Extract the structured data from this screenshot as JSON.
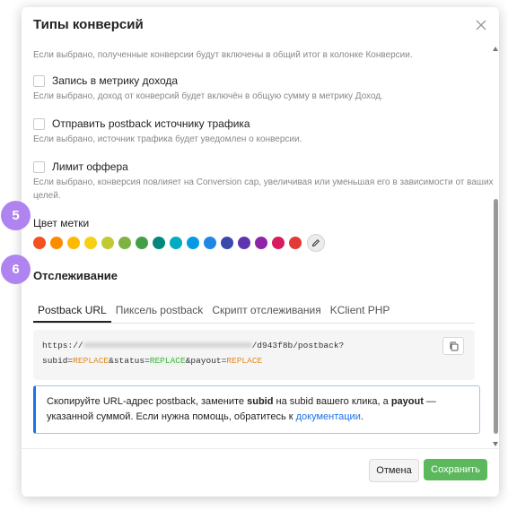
{
  "dialog": {
    "title": "Типы конверсий"
  },
  "hints": {
    "top": "Если выбрано, полученные конверсии будут включены в общий итог в колонке Конверсии.",
    "revenue": "Если выбрано, доход от конверсий будет включён в общую сумму в метрику Доход.",
    "postback": "Если выбрано, источник трафика будет уведомлен о конверсии.",
    "offer_limit_1": "Если выбрано, конверсия повлияет на Conversion cap, увеличивая или уменьшая его в зависимости от ваших",
    "offer_limit_2": "целей."
  },
  "options": {
    "revenue": "Запись в метрику дохода",
    "postback": "Отправить postback источнику трафика",
    "offer_limit": "Лимит оффера"
  },
  "label_color": {
    "title": "Цвет метки",
    "colors": [
      "#f4511e",
      "#fb8c00",
      "#fdb900",
      "#f7cf14",
      "#c0ca33",
      "#7cb342",
      "#43a047",
      "#00897b",
      "#00acc1",
      "#039be5",
      "#1e88e5",
      "#3949ab",
      "#5e35b1",
      "#8e24aa",
      "#d81b60",
      "#e53935"
    ],
    "edit_icon": "pencil-icon"
  },
  "tracking": {
    "title": "Отслеживание",
    "tabs": [
      "Postback URL",
      "Пиксель postback",
      "Скрипт отслеживания",
      "KClient PHP"
    ],
    "active_tab": "Postback URL",
    "url_prefix": "https://",
    "url_suffix": "/d943f8b/postback?",
    "params": {
      "subid": "subid",
      "status": "&status",
      "payout": "&payout",
      "replace": "REPLACE",
      "eq": "="
    },
    "copy_icon": "copy-icon"
  },
  "info": {
    "t1": "Скопируйте URL-адрес postback, замените ",
    "b1": "subid",
    "t2": " на subid вашего клика, а ",
    "b2": "payout",
    "t3": " —",
    "t4": "указанной суммой. Если нужна помощь, обратитесь к ",
    "link": "документации",
    "t5": "."
  },
  "buttons": {
    "cancel": "Отмена",
    "save": "Сохранить"
  },
  "steps": {
    "five": "5",
    "six": "6"
  },
  "colors": {
    "accent": "#1a73e8",
    "save": "#5cb85c",
    "step_badge": "#b084f0"
  }
}
